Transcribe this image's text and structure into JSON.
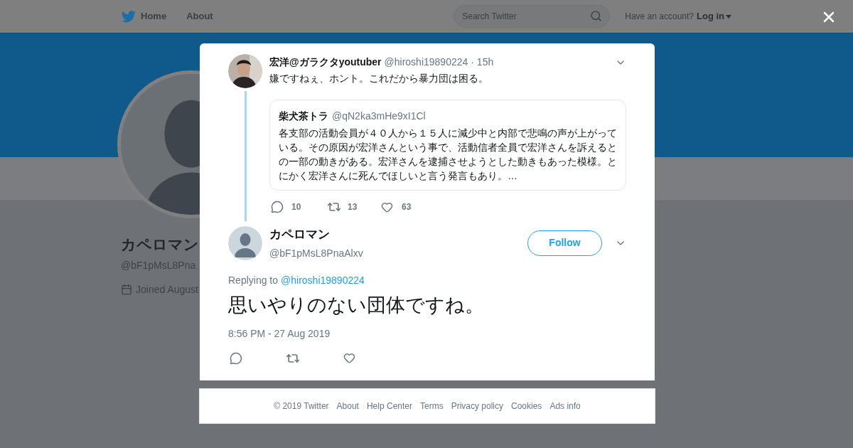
{
  "nav": {
    "items": [
      {
        "label": "Home"
      },
      {
        "label": "About"
      }
    ],
    "search": {
      "placeholder": "Search Twitter"
    },
    "account_prompt": "Have an account?",
    "login": "Log in"
  },
  "profile": {
    "name": "カペロマン",
    "handle": "@bF1pMsL8Pna",
    "joined": "Joined August"
  },
  "parent_tweet": {
    "name": "宏洋@ガラクタyoutuber",
    "handle": "@hiroshi19890224",
    "time": "· 15h",
    "text": "嫌ですねぇ、ホント。これだから暴力団は困る。",
    "quote": {
      "name": "柴犬茶トラ",
      "handle": "@qN2ka3mHe9xI1Cl",
      "text": "各支部の活動会員が４０人から１５人に減少中と内部で悲鳴の声が上がっている。その原因が宏洋さんという事で、活動信者全員で宏洋さんを訴えるとの一部の動きがある。宏洋さんを逮捕させようとした動きもあった模様。とにかく宏洋さんに死んでほしいと言う発言もあり。…"
    },
    "stats": {
      "replies": "10",
      "retweets": "13",
      "likes": "63"
    }
  },
  "tweet": {
    "name": "カペロマン",
    "handle": "@bF1pMsL8PnaAlxv",
    "follow": "Follow",
    "replying_label": "Replying to",
    "replying_to": "@hiroshi19890224",
    "text": "思いやりのない団体ですね。",
    "timestamp": "8:56 PM - 27 Aug 2019"
  },
  "footer": [
    "© 2019 Twitter",
    "About",
    "Help Center",
    "Terms",
    "Privacy policy",
    "Cookies",
    "Ads info"
  ]
}
